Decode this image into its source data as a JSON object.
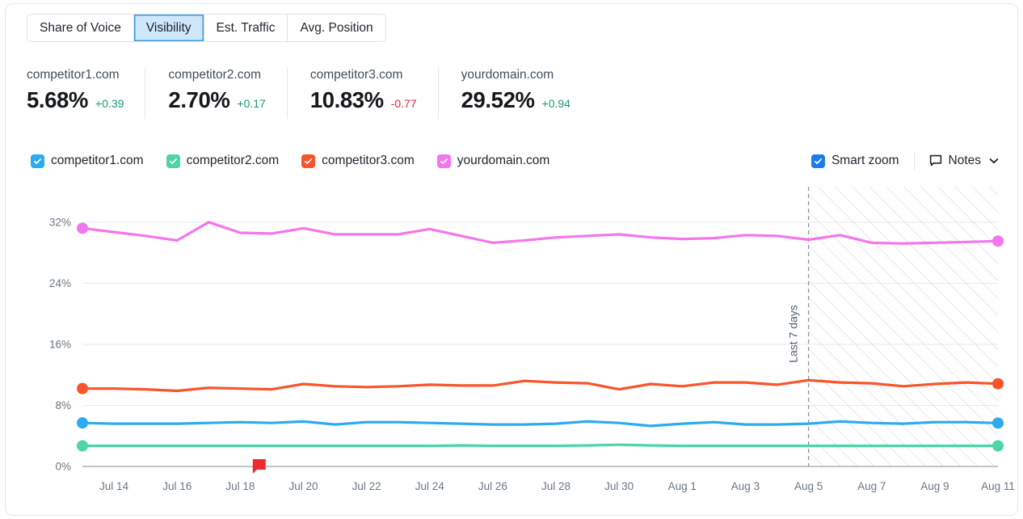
{
  "tabs": [
    {
      "label": "Share of Voice",
      "active": false
    },
    {
      "label": "Visibility",
      "active": true
    },
    {
      "label": "Est. Traffic",
      "active": false
    },
    {
      "label": "Avg. Position",
      "active": false
    }
  ],
  "metrics": [
    {
      "domain": "competitor1.com",
      "value": "5.68%",
      "delta": "+0.39",
      "direction": "up"
    },
    {
      "domain": "competitor2.com",
      "value": "2.70%",
      "delta": "+0.17",
      "direction": "up"
    },
    {
      "domain": "competitor3.com",
      "value": "10.83%",
      "delta": "-0.77",
      "direction": "down"
    },
    {
      "domain": "yourdomain.com",
      "value": "29.52%",
      "delta": "+0.94",
      "direction": "up"
    }
  ],
  "legend": [
    {
      "label": "competitor1.com",
      "color": "#2cabf0",
      "checked": true
    },
    {
      "label": "competitor2.com",
      "color": "#4ed5a3",
      "checked": true
    },
    {
      "label": "competitor3.com",
      "color": "#f8552a",
      "checked": true
    },
    {
      "label": "yourdomain.com",
      "color": "#f munchen",
      "checked": true
    }
  ],
  "legend_colors": [
    "#2cabf0",
    "#4ed5a3",
    "#f8552a",
    "#f476ec"
  ],
  "controls": {
    "smart_zoom_label": "Smart zoom",
    "smart_zoom_checked": true,
    "smart_zoom_color": "#1a7ee8",
    "notes_label": "Notes"
  },
  "chart_data": {
    "type": "line",
    "title": "",
    "xlabel": "",
    "ylabel": "",
    "ylim": [
      0,
      36
    ],
    "yticks": [
      0,
      8,
      16,
      24,
      32
    ],
    "ytick_labels": [
      "0%",
      "8%",
      "16%",
      "24%",
      "32%"
    ],
    "grid": true,
    "legend_position": "top",
    "x": [
      "Jul 13",
      "Jul 14",
      "Jul 15",
      "Jul 16",
      "Jul 17",
      "Jul 18",
      "Jul 19",
      "Jul 20",
      "Jul 21",
      "Jul 22",
      "Jul 23",
      "Jul 24",
      "Jul 25",
      "Jul 26",
      "Jul 27",
      "Jul 28",
      "Jul 29",
      "Jul 30",
      "Jul 31",
      "Aug 1",
      "Aug 2",
      "Aug 3",
      "Aug 4",
      "Aug 5",
      "Aug 6",
      "Aug 7",
      "Aug 8",
      "Aug 9",
      "Aug 10",
      "Aug 11"
    ],
    "xtick_labels": [
      "Jul 14",
      "Jul 16",
      "Jul 18",
      "Jul 20",
      "Jul 22",
      "Jul 24",
      "Jul 26",
      "Jul 28",
      "Jul 30",
      "Aug 1",
      "Aug 3",
      "Aug 5",
      "Aug 7",
      "Aug 9",
      "Aug 11"
    ],
    "forecast_label": "Last 7 days",
    "forecast_start_index": 23,
    "note_marker": {
      "label": "note",
      "x_index": 5.6,
      "color": "#ef2a2a"
    },
    "series": [
      {
        "name": "yourdomain.com",
        "color": "#f476ec",
        "end_value": 29.52,
        "values": [
          31.2,
          30.7,
          30.2,
          29.6,
          32.0,
          30.6,
          30.5,
          31.2,
          30.4,
          30.4,
          30.4,
          31.1,
          30.2,
          29.3,
          29.6,
          30.0,
          30.2,
          30.4,
          30.0,
          29.8,
          29.9,
          30.3,
          30.2,
          29.7,
          30.3,
          29.3,
          29.2,
          29.3,
          29.4,
          29.52
        ]
      },
      {
        "name": "competitor3.com",
        "color": "#f8552a",
        "end_value": 10.83,
        "values": [
          10.2,
          10.2,
          10.1,
          9.9,
          10.3,
          10.2,
          10.1,
          10.8,
          10.5,
          10.4,
          10.5,
          10.7,
          10.6,
          10.6,
          11.2,
          11.0,
          10.9,
          10.1,
          10.8,
          10.5,
          11.0,
          11.0,
          10.7,
          11.3,
          11.0,
          10.9,
          10.5,
          10.8,
          11.0,
          10.83
        ]
      },
      {
        "name": "competitor1.com",
        "color": "#2cabf0",
        "end_value": 5.68,
        "values": [
          5.7,
          5.6,
          5.6,
          5.6,
          5.7,
          5.8,
          5.7,
          5.9,
          5.5,
          5.8,
          5.8,
          5.7,
          5.6,
          5.5,
          5.5,
          5.6,
          5.9,
          5.7,
          5.3,
          5.6,
          5.8,
          5.5,
          5.5,
          5.6,
          5.9,
          5.7,
          5.6,
          5.8,
          5.8,
          5.68
        ]
      },
      {
        "name": "competitor2.com",
        "color": "#4ed5a3",
        "end_value": 2.7,
        "values": [
          2.7,
          2.7,
          2.7,
          2.7,
          2.7,
          2.7,
          2.7,
          2.7,
          2.7,
          2.7,
          2.7,
          2.7,
          2.75,
          2.7,
          2.7,
          2.7,
          2.75,
          2.85,
          2.75,
          2.7,
          2.7,
          2.7,
          2.7,
          2.7,
          2.7,
          2.7,
          2.7,
          2.7,
          2.7,
          2.7
        ]
      }
    ]
  }
}
